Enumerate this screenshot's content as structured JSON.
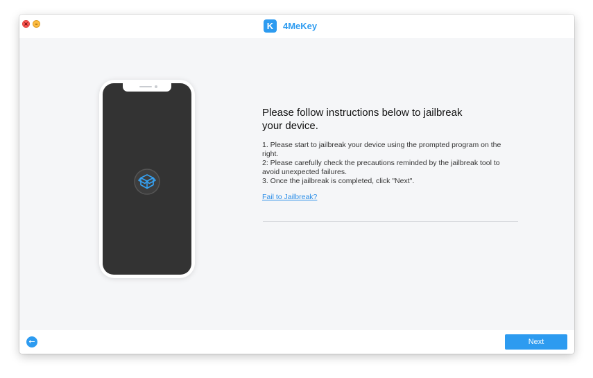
{
  "window": {
    "close_glyph": "×",
    "minimize_glyph": "–",
    "app_name": "4MeKey",
    "logo_letter": "K"
  },
  "colors": {
    "accent": "#2d9bf0",
    "link": "#2d8fe8",
    "phone_screen": "#333333",
    "background": "#f5f6f8"
  },
  "phone": {
    "center_icon": "cydia-box-icon"
  },
  "instructions": {
    "heading": "Please follow instructions below to jailbreak your device.",
    "steps": [
      "1. Please start to jailbreak your device using the prompted program on the right.",
      "2: Please carefully check the precautions reminded by the jailbreak tool to avoid unexpected failures.",
      "3. Once the jailbreak is completed, click \"Next\"."
    ],
    "fail_link": "Fail to Jailbreak?"
  },
  "footer": {
    "back_icon": "arrow-left-icon",
    "back_glyph": "←",
    "next_label": "Next"
  }
}
